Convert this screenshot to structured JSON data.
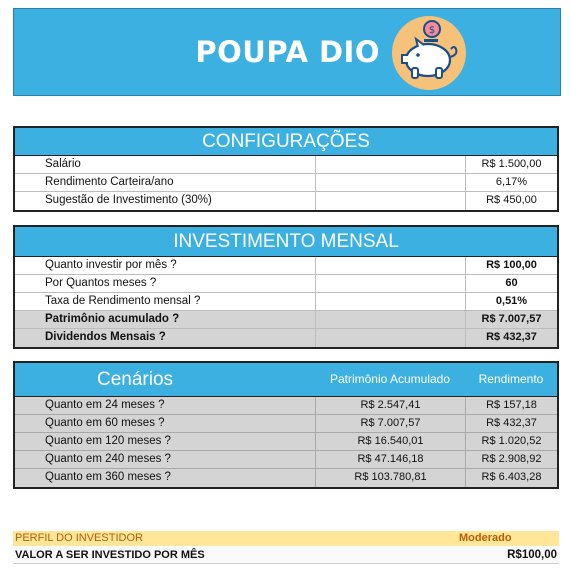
{
  "header": {
    "title": "POUPA DIO",
    "logo_icon": "piggy-bank-coin-icon"
  },
  "config": {
    "title": "CONFIGURAÇÕES",
    "rows": [
      {
        "label": "Salário",
        "value": "R$ 1.500,00"
      },
      {
        "label": "Rendimento Carteira/ano",
        "value": "6,17%"
      },
      {
        "label": "Sugestão de Investimento (30%)",
        "value": "R$ 450,00"
      }
    ]
  },
  "monthly": {
    "title": "INVESTIMENTO MENSAL",
    "rows": [
      {
        "label": "Quanto investir por mês ?",
        "value": "R$ 100,00"
      },
      {
        "label": "Por Quantos meses ?",
        "value": "60"
      },
      {
        "label": "Taxa de Rendimento mensal ?",
        "value": "0,51%"
      },
      {
        "label": "Patrimônio acumulado ?",
        "value": "R$ 7.007,57"
      },
      {
        "label": "Dividendos Mensais ?",
        "value": "R$ 432,37"
      }
    ]
  },
  "scenarios": {
    "title": "Cenários",
    "col_patrimonio": "Patrimônio Acumulado",
    "col_rendimento": "Rendimento",
    "rows": [
      {
        "label": "Quanto em 24 meses ?",
        "patrimonio": "R$ 2.547,41",
        "rendimento": "R$ 157,18"
      },
      {
        "label": "Quanto em 60 meses ?",
        "patrimonio": "R$ 7.007,57",
        "rendimento": "R$ 432,37"
      },
      {
        "label": "Quanto em 120 meses ?",
        "patrimonio": "R$ 16.540,01",
        "rendimento": "R$ 1.020,52"
      },
      {
        "label": "Quanto em 240 meses ?",
        "patrimonio": "R$ 47.146,18",
        "rendimento": "R$ 2.908,92"
      },
      {
        "label": "Quanto em 360 meses ?",
        "patrimonio": "R$ 103.780,81",
        "rendimento": "R$ 6.403,28"
      }
    ]
  },
  "profile": {
    "label": "PERFIL DO INVESTIDOR",
    "value": "Moderado"
  },
  "invest": {
    "label": "VALOR A SER INVESTIDO POR MÊS",
    "value": "R$100,00"
  },
  "colors": {
    "header_blue": "#3db0e2",
    "gray_row": "#d4d4d4",
    "profile_bg": "#ffe699",
    "profile_text": "#b45f06"
  }
}
